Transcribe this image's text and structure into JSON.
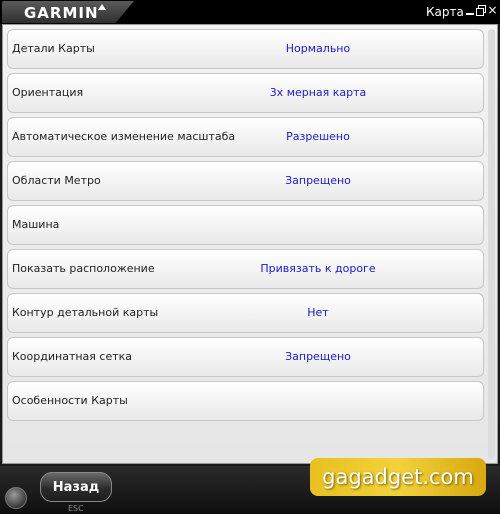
{
  "window": {
    "brand": "GARMIN",
    "title": "Карта"
  },
  "settings": [
    {
      "label": "Детали Карты",
      "value": "Нормально"
    },
    {
      "label": "Ориентация",
      "value": "3х мерная карта"
    },
    {
      "label": "Автоматическое изменение масштаба",
      "value": "Разрешено"
    },
    {
      "label": "Области Метро",
      "value": "Запрещено"
    },
    {
      "label": "Машина",
      "value": ""
    },
    {
      "label": "Показать расположение",
      "value": "Привязать к дороге"
    },
    {
      "label": "Контур детальной карты",
      "value": "Нет"
    },
    {
      "label": "Координатная сетка",
      "value": "Запрещено"
    },
    {
      "label": "Особенности Карты",
      "value": ""
    }
  ],
  "footer": {
    "back_label": "Назад",
    "esc_label": "ESC",
    "watermark": "gagadget.com"
  },
  "colors": {
    "value_text": "#1a1ac8",
    "watermark_bg": "#f2d23a"
  }
}
